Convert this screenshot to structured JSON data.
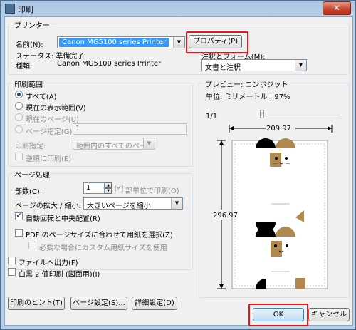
{
  "window": {
    "title": "印刷",
    "close_glyph": "✕"
  },
  "printer": {
    "group_label": "プリンター",
    "name_label": "名前(N):",
    "name_value": "Canon MG5100 series Printer",
    "status_label": "ステータス: 準備完了",
    "type_label": "種類:",
    "type_value": "Canon MG5100 series Printer",
    "properties_button": "プロパティ(P)",
    "comments_forms_label": "注釈とフォーム(M):",
    "comments_forms_value": "文書と注釈"
  },
  "print_range": {
    "group_label": "印刷範囲",
    "all": "すべて(A)",
    "current_view": "現在の表示範囲(V)",
    "current_page": "現在のページ(U)",
    "pages": "ページ指定(G)",
    "pages_value": "1",
    "subset_label": "印刷指定:",
    "subset_value": "範囲内のすべてのページ",
    "reverse": "逆順に印刷(E)"
  },
  "page_handling": {
    "group_label": "ページ処理",
    "copies_label": "部数(C):",
    "copies_value": "1",
    "collate": "部単位で印刷(O)",
    "scaling_label": "ページの拡大 / 縮小:",
    "scaling_value": "大きいページを縮小",
    "auto_rotate": "自動回転と中央配置(R)",
    "choose_paper": "PDF のページサイズに合わせて用紙を選択(Z)",
    "custom_paper": "必要な場合にカスタム用紙サイズを使用"
  },
  "options": {
    "print_to_file": "ファイルへ出力(F)",
    "grayscale": "白黒 2 値印刷 (図面用)(I)"
  },
  "preview": {
    "group_label": "プレビュー: コンポジット",
    "units_label": "単位: ミリメートル : 97%",
    "page_counter": "1/1",
    "width_value": "209.97",
    "height_value": "296.97"
  },
  "buttons": {
    "tips": "印刷のヒント(T)",
    "page_setup": "ページ設定(S)...",
    "advanced": "詳細設定(D)",
    "ok": "OK",
    "cancel": "キャンセル"
  },
  "colors": {
    "highlight": "#e8141b",
    "selection": "#3399ff",
    "cat_brown": "#b08950"
  },
  "icons": {
    "check": "✔",
    "combo_arrow": "▼",
    "spin_up": "▲",
    "spin_down": "▼"
  }
}
